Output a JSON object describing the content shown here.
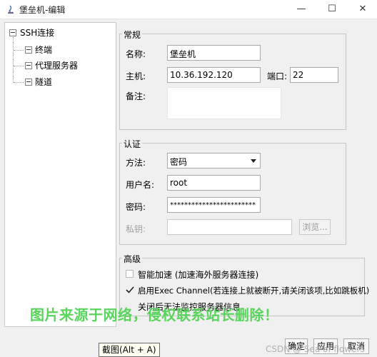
{
  "window": {
    "title": "堡垒机-编辑",
    "controls": [
      "—",
      "☐",
      "✕"
    ]
  },
  "tree": {
    "root": "SSH连接",
    "children": [
      "终端",
      "代理服务器",
      "隧道"
    ]
  },
  "general": {
    "legend": "常规",
    "name_label": "名称:",
    "name_value": "堡垒机",
    "host_label": "主机:",
    "host_value": "10.36.192.120",
    "port_label": "端口:",
    "port_value": "22",
    "note_label": "备注:",
    "note_value": ""
  },
  "auth": {
    "legend": "认证",
    "method_label": "方法:",
    "method_value": "密码",
    "user_label": "用户名:",
    "user_value": "root",
    "password_label": "密码:",
    "password_value": "************************",
    "key_label": "私钥:",
    "key_value": "",
    "browse_label": "浏览..."
  },
  "advanced": {
    "legend": "高级",
    "smart_accel_label": "智能加速 (加速海外服务器连接)",
    "smart_accel_checked": false,
    "exec_channel_label": "启用Exec Channel(若连接上就被断开,请关闭该项,比如跳板机)",
    "exec_channel_checked": true,
    "exec_note": "关闭后无法监控服务器信息"
  },
  "buttons": {
    "ok": "确定",
    "apply": "应用",
    "cancel": "取消"
  },
  "overlay": {
    "watermark": "图片来源于网络，侵权联系站长删除！",
    "tooltip": "截图(Alt + A)",
    "csdn": "CSDN @ Sea of flowers"
  },
  "colors": {
    "watermark": "#59d45d",
    "tooltip_bg": "#fffff2"
  }
}
